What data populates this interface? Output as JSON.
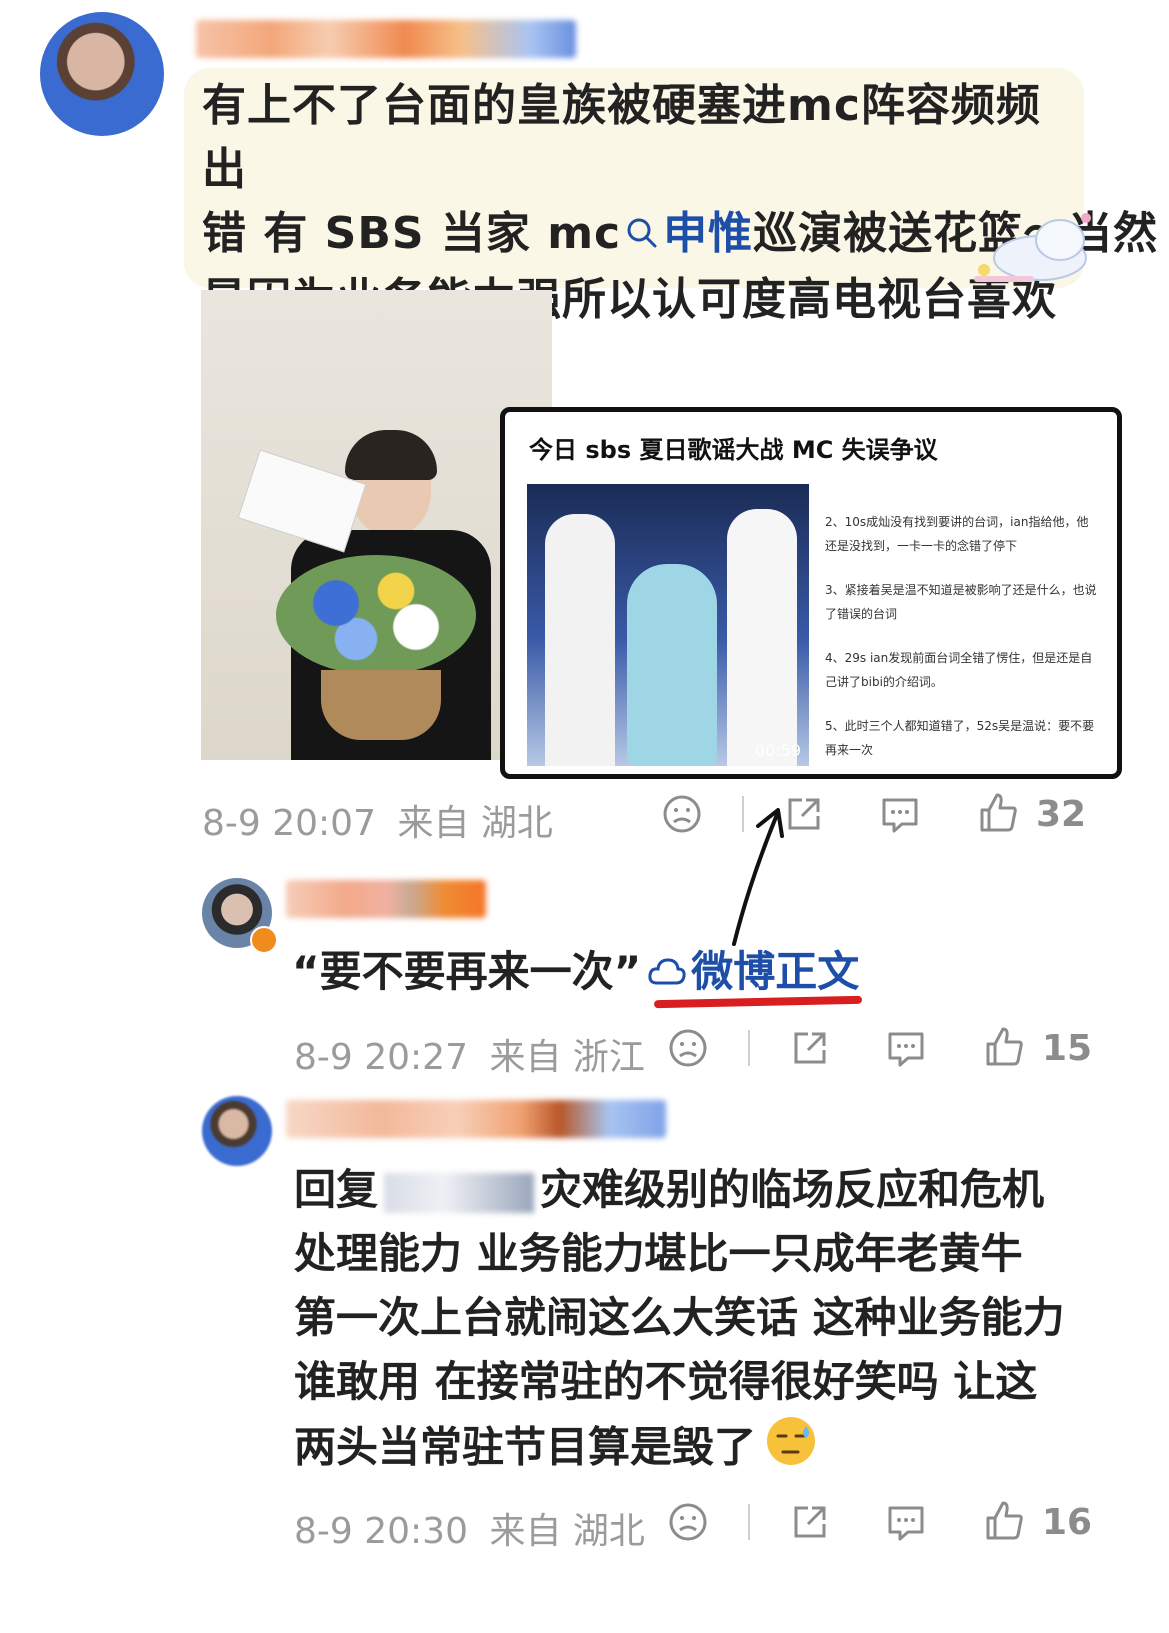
{
  "post": {
    "text_line1": "有上不了台面的皇族被硬塞进mc阵容频频出",
    "text_line2_pre": "错 有 SBS 当家 mc",
    "text_line2_link": "申惟",
    "text_line2_post": "巡演被送花篮～当然",
    "text_line3": "是因为业务能力强所以认可度高电视台喜欢呀",
    "timestamp": "8-9 20:07",
    "location": "来自 湖北",
    "likes": "32"
  },
  "embedded": {
    "title": "今日 sbs 夏日歌谣大战 MC 失误争议",
    "video_time": "00:59",
    "points": [
      "2、10s成灿没有找到要讲的台词，ian指给他，他还是没找到，一卡一卡的念错了停下",
      "3、紧接着吴是温不知道是被影响了还是什么，也说了错误的台词",
      "4、29s ian发现前面台词全错了愣住，但是还是自己讲了bibi的介绍词。",
      "5、此时三个人都知道错了，52s吴是温说：要不要再来一次"
    ]
  },
  "reply1": {
    "quote": "“要不要再来一次”",
    "link_label": "微博正文",
    "timestamp": "8-9 20:27",
    "location": "来自 浙江",
    "likes": "15"
  },
  "reply2": {
    "prefix": "回复",
    "line1": "灾难级别的临场反应和危机",
    "line2": "处理能力 业务能力堪比一只成年老黄牛",
    "line3": "第一次上台就闹这么大笑话 这种业务能力",
    "line4": "谁敢用 在接常驻的不觉得很好笑吗 让这",
    "line5": "两头当常驻节目算是毁了",
    "timestamp": "8-9 20:30",
    "location": "来自 湖北",
    "likes": "16"
  },
  "icons": {
    "search": "search-icon",
    "dislike": "sad-face-icon",
    "share": "share-icon",
    "comment": "comment-icon",
    "like": "thumbs-up-icon",
    "weibo": "weibo-cloud-icon"
  },
  "colors": {
    "link": "#1e4fa8",
    "meta": "#9b9b9b",
    "bubble": "#fbf7e6",
    "underline": "#d81e1e"
  }
}
